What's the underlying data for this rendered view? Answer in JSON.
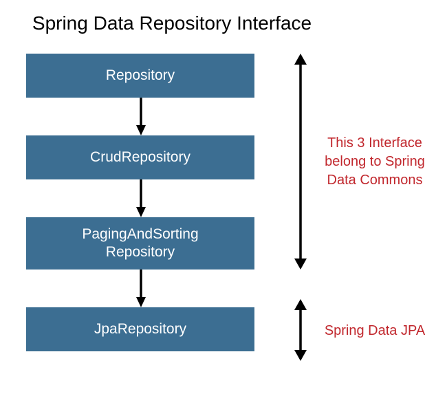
{
  "title": "Spring Data Repository Interface",
  "boxes": {
    "b1": "Repository",
    "b2": "CrudRepository",
    "b3": "PagingAndSorting\nRepository",
    "b4": "JpaRepository"
  },
  "annotations": {
    "commons": "This 3 Interface\nbelong to Spring\nData Commons",
    "jpa": "Spring Data JPA"
  }
}
